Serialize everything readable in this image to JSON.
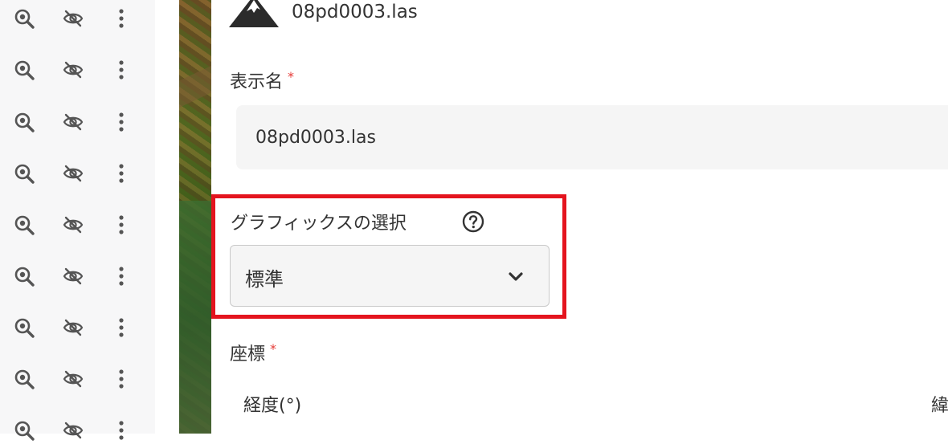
{
  "sidebar": {
    "rows": [
      {
        "zoom_icon": "zoom-in-icon",
        "visibility_icon": "eye-off-icon",
        "menu_icon": "more-vertical-icon"
      },
      {
        "zoom_icon": "zoom-in-icon",
        "visibility_icon": "eye-off-icon",
        "menu_icon": "more-vertical-icon"
      },
      {
        "zoom_icon": "zoom-in-icon",
        "visibility_icon": "eye-off-icon",
        "menu_icon": "more-vertical-icon"
      },
      {
        "zoom_icon": "zoom-in-icon",
        "visibility_icon": "eye-off-icon",
        "menu_icon": "more-vertical-icon"
      },
      {
        "zoom_icon": "zoom-in-icon",
        "visibility_icon": "eye-off-icon",
        "menu_icon": "more-vertical-icon"
      },
      {
        "zoom_icon": "zoom-in-icon",
        "visibility_icon": "eye-off-icon",
        "menu_icon": "more-vertical-icon"
      },
      {
        "zoom_icon": "zoom-in-icon",
        "visibility_icon": "eye-off-icon",
        "menu_icon": "more-vertical-icon"
      },
      {
        "zoom_icon": "zoom-in-icon",
        "visibility_icon": "eye-off-icon",
        "menu_icon": "more-vertical-icon"
      },
      {
        "zoom_icon": "zoom-in-icon",
        "visibility_icon": "eye-off-icon",
        "menu_icon": "more-vertical-icon"
      }
    ],
    "icon_color": "#555555"
  },
  "header": {
    "icon": "mountain-icon",
    "filename": "08pd0003.las"
  },
  "display_name": {
    "label": "表示名",
    "required_mark": "*",
    "value": "08pd0003.las"
  },
  "graphics": {
    "label": "グラフィックスの選択",
    "help_icon": "question-circle-icon",
    "selected": "標準",
    "highlight_color": "#e4141e"
  },
  "coordinates": {
    "label": "座標",
    "required_mark": "*",
    "longitude_label": "経度(°)",
    "latitude_label_partial": "緯"
  },
  "colors": {
    "required": "#e53935",
    "input_bg": "#f5f5f5",
    "sidebar_bg": "#f7f7f8"
  }
}
